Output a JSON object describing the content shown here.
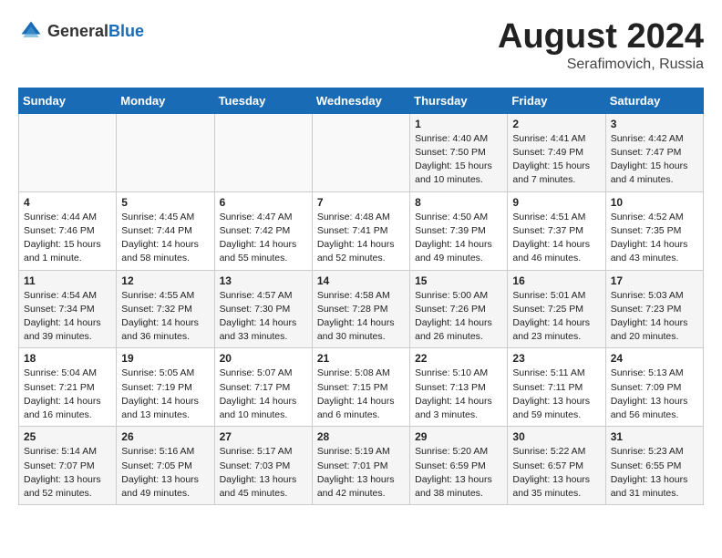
{
  "header": {
    "logo_general": "General",
    "logo_blue": "Blue",
    "month_year": "August 2024",
    "location": "Serafimovich, Russia"
  },
  "weekdays": [
    "Sunday",
    "Monday",
    "Tuesday",
    "Wednesday",
    "Thursday",
    "Friday",
    "Saturday"
  ],
  "weeks": [
    [
      {
        "day": "",
        "content": ""
      },
      {
        "day": "",
        "content": ""
      },
      {
        "day": "",
        "content": ""
      },
      {
        "day": "",
        "content": ""
      },
      {
        "day": "1",
        "content": "Sunrise: 4:40 AM\nSunset: 7:50 PM\nDaylight: 15 hours\nand 10 minutes."
      },
      {
        "day": "2",
        "content": "Sunrise: 4:41 AM\nSunset: 7:49 PM\nDaylight: 15 hours\nand 7 minutes."
      },
      {
        "day": "3",
        "content": "Sunrise: 4:42 AM\nSunset: 7:47 PM\nDaylight: 15 hours\nand 4 minutes."
      }
    ],
    [
      {
        "day": "4",
        "content": "Sunrise: 4:44 AM\nSunset: 7:46 PM\nDaylight: 15 hours\nand 1 minute."
      },
      {
        "day": "5",
        "content": "Sunrise: 4:45 AM\nSunset: 7:44 PM\nDaylight: 14 hours\nand 58 minutes."
      },
      {
        "day": "6",
        "content": "Sunrise: 4:47 AM\nSunset: 7:42 PM\nDaylight: 14 hours\nand 55 minutes."
      },
      {
        "day": "7",
        "content": "Sunrise: 4:48 AM\nSunset: 7:41 PM\nDaylight: 14 hours\nand 52 minutes."
      },
      {
        "day": "8",
        "content": "Sunrise: 4:50 AM\nSunset: 7:39 PM\nDaylight: 14 hours\nand 49 minutes."
      },
      {
        "day": "9",
        "content": "Sunrise: 4:51 AM\nSunset: 7:37 PM\nDaylight: 14 hours\nand 46 minutes."
      },
      {
        "day": "10",
        "content": "Sunrise: 4:52 AM\nSunset: 7:35 PM\nDaylight: 14 hours\nand 43 minutes."
      }
    ],
    [
      {
        "day": "11",
        "content": "Sunrise: 4:54 AM\nSunset: 7:34 PM\nDaylight: 14 hours\nand 39 minutes."
      },
      {
        "day": "12",
        "content": "Sunrise: 4:55 AM\nSunset: 7:32 PM\nDaylight: 14 hours\nand 36 minutes."
      },
      {
        "day": "13",
        "content": "Sunrise: 4:57 AM\nSunset: 7:30 PM\nDaylight: 14 hours\nand 33 minutes."
      },
      {
        "day": "14",
        "content": "Sunrise: 4:58 AM\nSunset: 7:28 PM\nDaylight: 14 hours\nand 30 minutes."
      },
      {
        "day": "15",
        "content": "Sunrise: 5:00 AM\nSunset: 7:26 PM\nDaylight: 14 hours\nand 26 minutes."
      },
      {
        "day": "16",
        "content": "Sunrise: 5:01 AM\nSunset: 7:25 PM\nDaylight: 14 hours\nand 23 minutes."
      },
      {
        "day": "17",
        "content": "Sunrise: 5:03 AM\nSunset: 7:23 PM\nDaylight: 14 hours\nand 20 minutes."
      }
    ],
    [
      {
        "day": "18",
        "content": "Sunrise: 5:04 AM\nSunset: 7:21 PM\nDaylight: 14 hours\nand 16 minutes."
      },
      {
        "day": "19",
        "content": "Sunrise: 5:05 AM\nSunset: 7:19 PM\nDaylight: 14 hours\nand 13 minutes."
      },
      {
        "day": "20",
        "content": "Sunrise: 5:07 AM\nSunset: 7:17 PM\nDaylight: 14 hours\nand 10 minutes."
      },
      {
        "day": "21",
        "content": "Sunrise: 5:08 AM\nSunset: 7:15 PM\nDaylight: 14 hours\nand 6 minutes."
      },
      {
        "day": "22",
        "content": "Sunrise: 5:10 AM\nSunset: 7:13 PM\nDaylight: 14 hours\nand 3 minutes."
      },
      {
        "day": "23",
        "content": "Sunrise: 5:11 AM\nSunset: 7:11 PM\nDaylight: 13 hours\nand 59 minutes."
      },
      {
        "day": "24",
        "content": "Sunrise: 5:13 AM\nSunset: 7:09 PM\nDaylight: 13 hours\nand 56 minutes."
      }
    ],
    [
      {
        "day": "25",
        "content": "Sunrise: 5:14 AM\nSunset: 7:07 PM\nDaylight: 13 hours\nand 52 minutes."
      },
      {
        "day": "26",
        "content": "Sunrise: 5:16 AM\nSunset: 7:05 PM\nDaylight: 13 hours\nand 49 minutes."
      },
      {
        "day": "27",
        "content": "Sunrise: 5:17 AM\nSunset: 7:03 PM\nDaylight: 13 hours\nand 45 minutes."
      },
      {
        "day": "28",
        "content": "Sunrise: 5:19 AM\nSunset: 7:01 PM\nDaylight: 13 hours\nand 42 minutes."
      },
      {
        "day": "29",
        "content": "Sunrise: 5:20 AM\nSunset: 6:59 PM\nDaylight: 13 hours\nand 38 minutes."
      },
      {
        "day": "30",
        "content": "Sunrise: 5:22 AM\nSunset: 6:57 PM\nDaylight: 13 hours\nand 35 minutes."
      },
      {
        "day": "31",
        "content": "Sunrise: 5:23 AM\nSunset: 6:55 PM\nDaylight: 13 hours\nand 31 minutes."
      }
    ]
  ]
}
